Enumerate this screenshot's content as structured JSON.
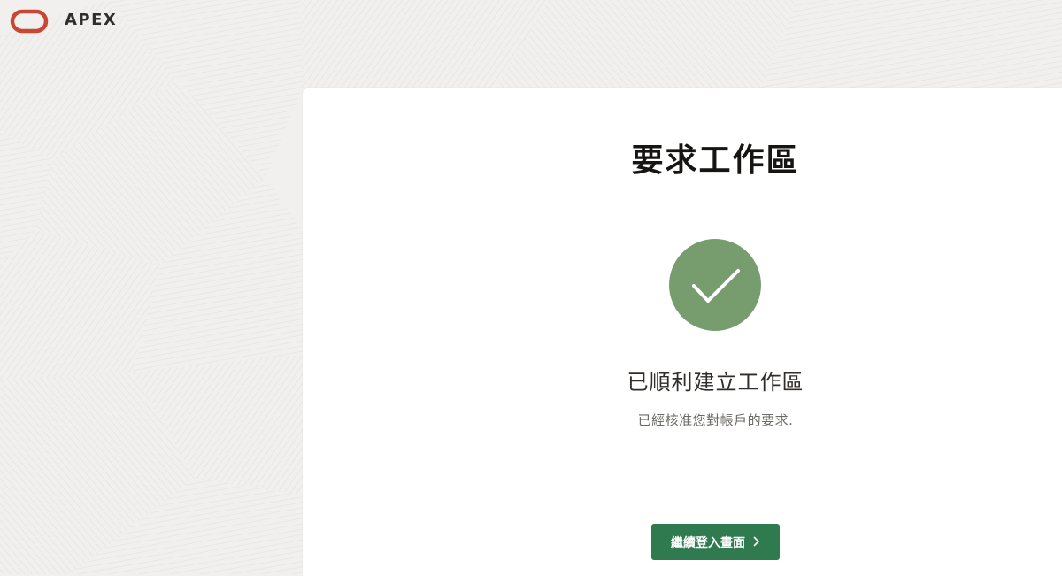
{
  "header": {
    "app_name": "APEX",
    "logo_icon": "oracle-logo-icon",
    "logo_color": "#c74634"
  },
  "main": {
    "title": "要求工作區",
    "status_icon": "checkmark-circle-icon",
    "status_color": "#779d6e",
    "heading": "已順利建立工作區",
    "message": "已經核准您對帳戶的要求.",
    "continue_button": {
      "label": "繼續登入畫面",
      "icon": "chevron-right-icon",
      "color": "#2f7a4f"
    }
  },
  "colors": {
    "background": "#f1f0ee",
    "card": "#ffffff"
  }
}
